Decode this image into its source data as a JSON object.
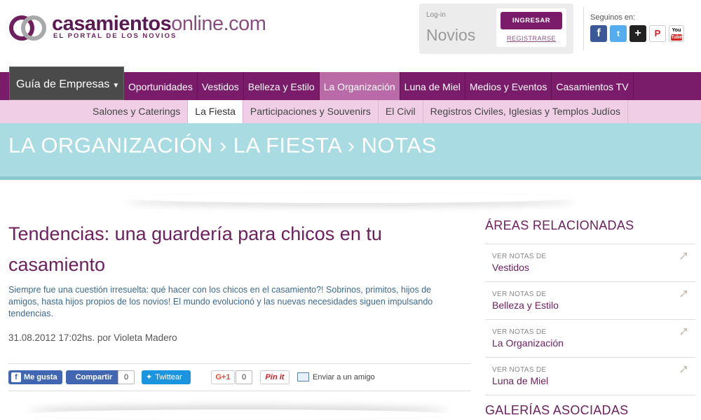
{
  "brand": {
    "name_part1": "casamientos",
    "name_part2": "online",
    "name_part3": ".com",
    "tagline": "EL PORTAL DE LOS NOVIOS",
    "color_primary": "#7a1c6a",
    "color_band": "#a9dbe2"
  },
  "login": {
    "label": "Log-in",
    "audience": "Novios",
    "login_button": "INGRESAR",
    "register_link": "REGISTRARSE"
  },
  "social": {
    "label": "Seguinos en:",
    "icons": [
      "facebook-icon",
      "twitter-icon",
      "delicious-icon",
      "pinterest-icon",
      "youtube-icon"
    ],
    "fb_glyph": "f",
    "tw_glyph": "t",
    "del_glyph": "+",
    "pin_glyph": "P",
    "yt_top": "You",
    "yt_bottom": "Tube"
  },
  "main_nav": {
    "guide": "Guía de Empresas",
    "items": [
      "Oportunidades",
      "Vestidos",
      "Belleza y Estilo",
      "La Organización",
      "Luna de Miel",
      "Medios y Eventos",
      "Casamientos TV"
    ],
    "active": "La Organización"
  },
  "sub_nav": {
    "items": [
      "Salones y Caterings",
      "La Fiesta",
      "Participaciones y Souvenirs",
      "El Civil",
      "Registros Civiles, Iglesias y Templos Judíos"
    ],
    "active": "La Fiesta"
  },
  "breadcrumb": "LA ORGANIZACIÓN › LA FIESTA › NOTAS",
  "article": {
    "title": "Tendencias: una guardería para chicos en tu casamiento",
    "lead": "Siempre fue una cuestión irresuelta: qué hacer con los chicos en el casamiento?! Sobrinos, primitos, hijos de amigos, hasta hijos propios de los novios! El mundo evolucionó y las nuevas necesidades siguen impulsando tendencias.",
    "meta": "31.08.2012 17:02hs. por Violeta Madero"
  },
  "share": {
    "like": "Me gusta",
    "share": "Compartir",
    "fb_count": "0",
    "tweet": "Twittear",
    "gplus": "G+1",
    "gplus_count": "0",
    "pin": "Pin it",
    "mail": "Enviar a un amigo"
  },
  "sidebar": {
    "related_heading": "ÁREAS RELACIONADAS",
    "related": [
      {
        "kicker": "VER NOTAS DE",
        "name": "Vestidos"
      },
      {
        "kicker": "VER NOTAS DE",
        "name": "Belleza y Estilo"
      },
      {
        "kicker": "VER NOTAS DE",
        "name": "La Organización"
      },
      {
        "kicker": "VER NOTAS DE",
        "name": "Luna de Miel"
      }
    ],
    "galleries_heading": "GALERÍAS ASOCIADAS"
  }
}
